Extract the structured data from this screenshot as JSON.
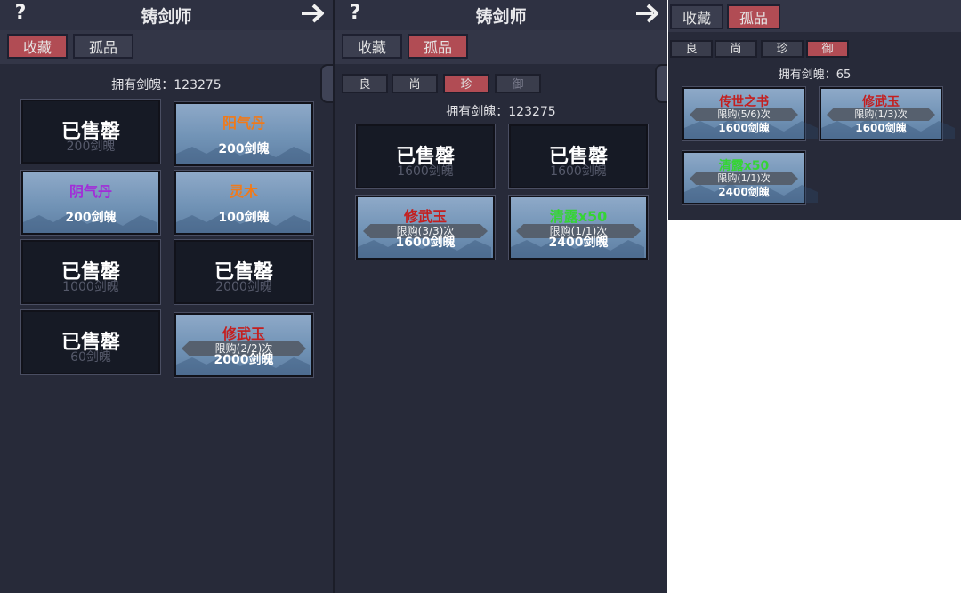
{
  "colors": {
    "panel": "#272a39",
    "active_tab": "#b14c54",
    "name_red": "#c41f1f",
    "name_green": "#35d435",
    "name_orange": "#f07a1a",
    "name_purple": "#a22cd8"
  },
  "panel1": {
    "title": "铸剑师",
    "tabs": [
      {
        "label": "收藏",
        "active": true
      },
      {
        "label": "孤品",
        "active": false
      }
    ],
    "owned": "拥有剑魄：123275",
    "items": [
      {
        "name": "",
        "price": "200剑魄",
        "status": "已售罄",
        "sold": true
      },
      {
        "name": "阳气丹",
        "name_color": "#f07a1a",
        "price": "200剑魄",
        "sold": false
      },
      {
        "name": "阴气丹",
        "name_color": "#a22cd8",
        "price": "200剑魄",
        "sold": false
      },
      {
        "name": "灵木",
        "name_color": "#f07a1a",
        "price": "100剑魄",
        "sold": false
      },
      {
        "name": "",
        "price": "1000剑魄",
        "status": "已售罄",
        "sold": true
      },
      {
        "name": "",
        "price": "2000剑魄",
        "status": "已售罄",
        "sold": true
      },
      {
        "name": "",
        "price": "60剑魄",
        "status": "已售罄",
        "sold": true
      },
      {
        "name": "修武玉",
        "name_color": "#c41f1f",
        "limit": "限购(2/2)次",
        "price": "2000剑魄",
        "sold": false
      }
    ]
  },
  "panel2": {
    "title": "铸剑师",
    "tabs": [
      {
        "label": "收藏",
        "active": false
      },
      {
        "label": "孤品",
        "active": true
      }
    ],
    "subtabs": [
      {
        "label": "良",
        "active": false
      },
      {
        "label": "尚",
        "active": false
      },
      {
        "label": "珍",
        "active": true
      },
      {
        "label": "御",
        "active": false
      }
    ],
    "owned": "拥有剑魄：123275",
    "items": [
      {
        "name": "",
        "price": "1600剑魄",
        "status": "已售罄",
        "sold": true
      },
      {
        "name": "",
        "price": "1600剑魄",
        "status": "已售罄",
        "sold": true
      },
      {
        "name": "修武玉",
        "name_color": "#c41f1f",
        "limit": "限购(3/3)次",
        "price": "1600剑魄",
        "sold": false
      },
      {
        "name": "清露x50",
        "name_color": "#35d435",
        "limit": "限购(1/1)次",
        "price": "2400剑魄",
        "sold": false
      }
    ]
  },
  "panel3": {
    "tabs": [
      {
        "label": "收藏",
        "active": false
      },
      {
        "label": "孤品",
        "active": true
      }
    ],
    "subtabs": [
      {
        "label": "良",
        "active": false
      },
      {
        "label": "尚",
        "active": false
      },
      {
        "label": "珍",
        "active": false
      },
      {
        "label": "御",
        "active": true
      }
    ],
    "owned": "拥有剑魄：65",
    "items": [
      {
        "name": "传世之书",
        "name_color": "#c41f1f",
        "limit": "限购(5/6)次",
        "price": "1600剑魄",
        "sold": false
      },
      {
        "name": "修武玉",
        "name_color": "#c41f1f",
        "limit": "限购(1/3)次",
        "price": "1600剑魄",
        "sold": false
      },
      {
        "name": "清露x50",
        "name_color": "#35d435",
        "limit": "限购(1/1)次",
        "price": "2400剑魄",
        "sold": false
      }
    ]
  }
}
